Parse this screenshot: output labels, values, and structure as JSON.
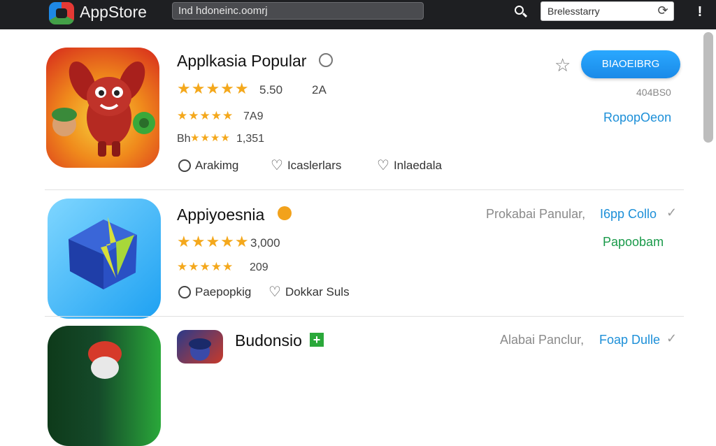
{
  "topbar": {
    "brand": "AppStore",
    "url": "Ind hdoneinc.oomrj",
    "search_value": "Brelesstarry",
    "refresh_icon": "refresh-icon",
    "menu_icon": "more-vert-icon"
  },
  "apps": [
    {
      "title": "Applkasia Popular",
      "rating_main": "5.50",
      "rating_aux": "2A",
      "rating2": "7A9",
      "rating3_prefix": "Bh",
      "rating3": "1,351",
      "actions": [
        "Arakimg",
        "Icaslerlars",
        "Inlaedala"
      ],
      "button": "BIAOEIBRG",
      "size": "404BS0",
      "link": "RopopOeon"
    },
    {
      "title": "Appiyoesnia",
      "rating_main": "3,000",
      "rating2": "209",
      "actions": [
        "Paepopkig",
        "Dokkar Suls"
      ],
      "right_grey": "Prokabai Panular,",
      "right_link": "I6pp Collo",
      "right_green": "Papoobam"
    },
    {
      "title": "Budonsio",
      "right_grey": "Alabai Panclur,",
      "right_link": "Foap Dulle"
    }
  ],
  "colors": {
    "accent": "#1a8ae8",
    "star": "#f4a81c",
    "green": "#1a9a4a"
  }
}
